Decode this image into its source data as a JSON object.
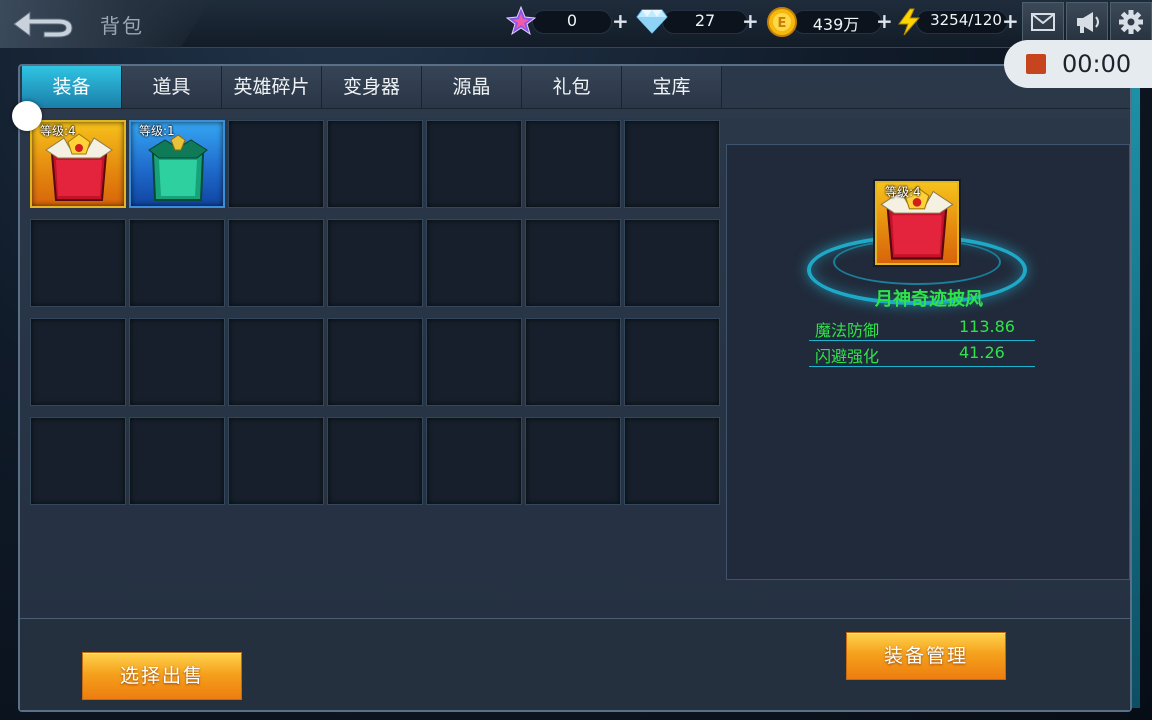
{
  "header": {
    "title": "背包"
  },
  "resources": {
    "star_value": "0",
    "diamond_value": "27",
    "gold_value": "439万",
    "energy_value": "3254/120",
    "plus": "+"
  },
  "recording": {
    "time": "00:00"
  },
  "tabs": [
    {
      "label": "装备",
      "active": true
    },
    {
      "label": "道具",
      "active": false
    },
    {
      "label": "英雄碎片",
      "active": false
    },
    {
      "label": "变身器",
      "active": false
    },
    {
      "label": "源晶",
      "active": false
    },
    {
      "label": "礼包",
      "active": false
    },
    {
      "label": "宝库",
      "active": false
    }
  ],
  "inventory": {
    "items": [
      {
        "level_text": "等级:4",
        "icon": "red-cape-icon"
      },
      {
        "level_text": "等级:1",
        "icon": "green-cape-icon"
      }
    ]
  },
  "detail": {
    "level_text": "等级:4",
    "name": "月神奇迹披风",
    "stats": [
      {
        "label": "魔法防御",
        "value": "113.86"
      },
      {
        "label": "闪避强化",
        "value": "41.26"
      }
    ]
  },
  "buttons": {
    "sell_label": "选择出售",
    "manage_label": "装备管理"
  },
  "colors": {
    "active_tab": "#2fc4e3",
    "stat_text": "#2ee34a",
    "button": "#f5a11c"
  }
}
